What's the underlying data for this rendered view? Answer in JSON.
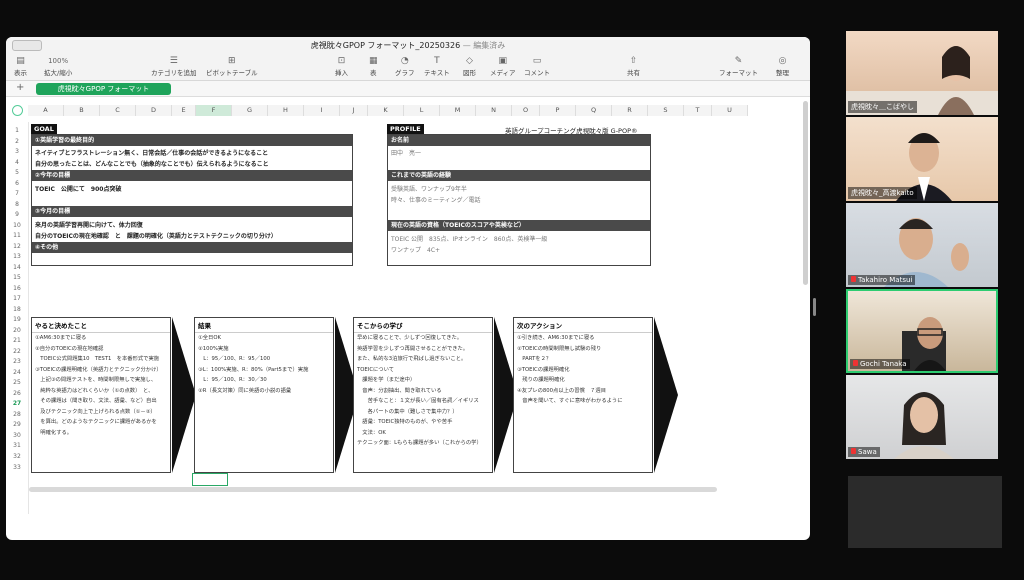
{
  "app": {
    "title": "虎視眈々GPOP フォーマット_20250326",
    "status": "— 編集済み"
  },
  "toolbar": {
    "view": "表示",
    "zoom_value": "100%",
    "zoom": "拡大/縮小",
    "add_category": "カテゴリを追加",
    "pivot": "ピボットテーブル",
    "insert": "挿入",
    "table": "表",
    "chart": "グラフ",
    "text": "テキスト",
    "shape": "図形",
    "media": "メディア",
    "comment": "コメント",
    "share": "共有",
    "format": "フォーマット",
    "organize": "整理"
  },
  "sheet_tab": "虎視眈々GPOP フォーマット",
  "columns": [
    "A",
    "B",
    "C",
    "D",
    "E",
    "F",
    "G",
    "H",
    "I",
    "J",
    "K",
    "L",
    "M",
    "N",
    "O",
    "P",
    "Q",
    "R",
    "S",
    "T",
    "U"
  ],
  "rows": [
    "1",
    "2",
    "3",
    "4",
    "5",
    "6",
    "7",
    "8",
    "9",
    "10",
    "11",
    "12",
    "13",
    "14",
    "15",
    "16",
    "17",
    "18",
    "19",
    "20",
    "21",
    "22",
    "23",
    "24",
    "25",
    "26",
    "27",
    "28",
    "29",
    "30",
    "31",
    "32",
    "33"
  ],
  "selected_row": "27",
  "goal": {
    "label": "GOAL",
    "s1": "①英語学習の最終目的",
    "s1a": "ネイティブとフラストレーション無く、日常会話／仕事の会話ができるようになること",
    "s1b": "自分の思ったことは、どんなことでも（抽象的なことでも）伝えられるようになること",
    "s2": "②今年の目標",
    "s2a": "TOEIC　公開にて　900点突破",
    "s3": "③今月の目標",
    "s3a": "来月の英語学習再開に向けて、体力回復",
    "s3b": "自分のTOEICの現在地確認　と　課題の明確化（英語力とテストテクニックの切り分け）",
    "s4": "④その他"
  },
  "profile": {
    "label": "PROFILE",
    "title": "英語グループコーチング虎視眈々版 G-POP®",
    "name_h": "お名前",
    "name": "田中　亮一",
    "exp_h": "これまでの英語の経験",
    "exp1": "受験英語、ワンナップ9年半",
    "exp2": "時々、仕事のミーティング／電話",
    "level_h": "現在の英語の資格（TOEICのスコアや英検など）",
    "level1": "TOEIC 公開　835点、IPオンライン　860点、英検準一級",
    "level2": "ワンナップ　4C+"
  },
  "cols": [
    {
      "h": "やると決めたこと",
      "lines": [
        "①AM6:30までに寝る",
        "",
        "②自分のTOEICの現在地確認",
        "　TOEIC公式問題集10　TEST1　を本番形式で実施",
        "",
        "③TOEICの課題明確化（英語力とテクニック分かけ）",
        "　上記③の問題テストを、時間制限無しで実施し、",
        "　純粋な英語力はどれくらいか（①の点数）　と、",
        "　その課題は（聞き取り、文法、語彙、など）自出",
        "　及びテクニック向上で上げられる点数（①－②）",
        "　を算出。どのようなテクニックに課題があるかを",
        "　明確化する。"
      ]
    },
    {
      "h": "結果",
      "lines": [
        "①全日OK",
        "②100%実施",
        "　L：95／100、R：95／100",
        "③L：100%実施、R：80%（Part5まで）実施",
        "　L：95／100、R：30／30",
        "",
        "②R（長文対策）同に英語の小説の語彙",
        ""
      ]
    },
    {
      "h": "そこからの学び",
      "lines": [
        "早めに寝ることで、少しずつ回復してきた。",
        "英語学習を少しずつ再開させることができた。",
        "また、私的な3泊旅行で飛ばし過ぎないこと。",
        "",
        "TOEICについて",
        "　課題を学（まだ途中）",
        "　音声：分割抽出、聞き取れている",
        "　　苦手なこと：１文が長い／固有名詞／イギリス",
        "　　各パートの集中（難しさで集中力？）",
        "　語彙：TOEIC独特のものが、やや苦手",
        "　文法：OK",
        "テクニック面：Lもらも課題が多い（これからの学）"
      ]
    },
    {
      "h": "次のアクション",
      "lines": [
        "①引き続き、AM6:30までに寝る",
        "",
        "②TOEICの時間制限無し試験の残り",
        "　PARTを２？",
        "",
        "③TOEICの課題明確化",
        "　残りの課題明確化",
        "",
        "④友プレの800点以上の習慣　７週目",
        "　音声を聞いて、すぐに意味がわかるように"
      ]
    }
  ],
  "video": [
    {
      "name": "虎視眈々＿こばやし"
    },
    {
      "name": "虎視眈々_高渡kaito"
    },
    {
      "name": "Takahiro Matsui"
    },
    {
      "name": "Gochi Tanaka"
    },
    {
      "name": "Sawa"
    }
  ]
}
